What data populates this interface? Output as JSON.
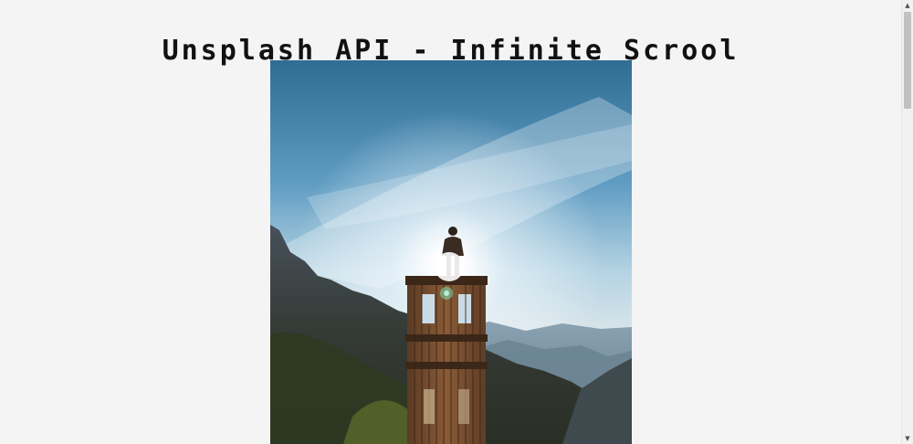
{
  "header": {
    "title": "Unsplash API - Infinite Scrool"
  },
  "gallery": {
    "images": [
      {
        "icon": "photo-man-on-wooden-tower-at-sunrise"
      }
    ]
  },
  "scrollbar": {
    "up_arrow": "▲",
    "down_arrow": "▼"
  },
  "colors": {
    "background": "#f4f4f4",
    "title_text": "#111111",
    "scroll_thumb": "#c1c1c1"
  }
}
